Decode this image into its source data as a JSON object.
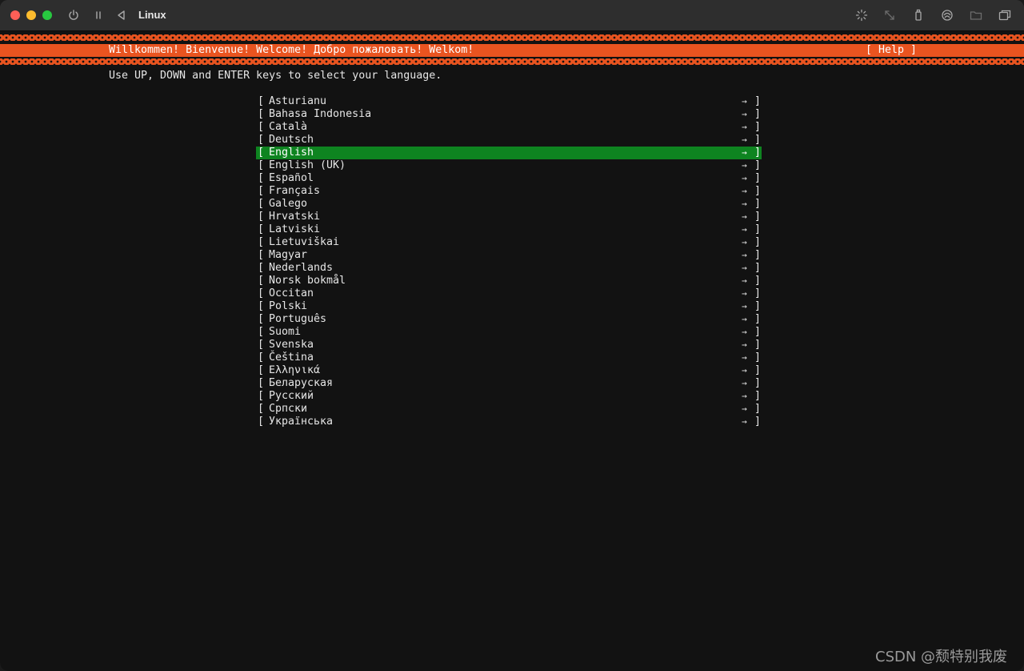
{
  "window": {
    "title": "Linux"
  },
  "toolbar_icons": [
    "power-icon",
    "pause-icon",
    "back-icon",
    "brightness-icon",
    "resize-icon",
    "usb-icon",
    "network-icon",
    "folder-icon",
    "windows-icon"
  ],
  "installer": {
    "banner": "Willkommen! Bienvenue! Welcome! Добро пожаловать! Welkom!",
    "help": "[ Help ]",
    "instruction": "Use UP, DOWN and ENTER keys to select your language.",
    "left_bracket": "[",
    "right_bracket": "]",
    "arrow": "→",
    "selected_index": 4,
    "accent_color": "#e95420",
    "selection_color": "#0e8420",
    "languages": [
      "Asturianu",
      "Bahasa Indonesia",
      "Català",
      "Deutsch",
      "English",
      "English (UK)",
      "Español",
      "Français",
      "Galego",
      "Hrvatski",
      "Latviski",
      "Lietuviškai",
      "Magyar",
      "Nederlands",
      "Norsk bokmål",
      "Occitan",
      "Polski",
      "Português",
      "Suomi",
      "Svenska",
      "Čeština",
      "Ελληνικά",
      "Беларуская",
      "Русский",
      "Српски",
      "Українська"
    ]
  },
  "watermark": "CSDN @颓特别我废"
}
